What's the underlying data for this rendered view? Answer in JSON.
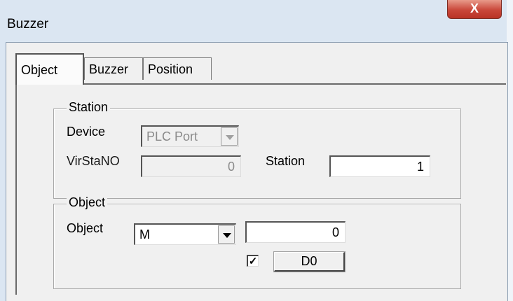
{
  "window": {
    "title": "Buzzer",
    "close_symbol": "X"
  },
  "tabs": [
    {
      "label": "Object",
      "active": true
    },
    {
      "label": "Buzzer",
      "active": false
    },
    {
      "label": "Position",
      "active": false
    }
  ],
  "station_group": {
    "label": "Station",
    "device_label": "Device",
    "device_value": "PLC Port",
    "virstano_label": "VirStaNO",
    "virstano_value": "0",
    "station_label": "Station",
    "station_value": "1"
  },
  "object_group": {
    "label": "Object",
    "object_label": "Object",
    "object_type": "M",
    "object_address": "0",
    "checkbox_checked": true,
    "checkbox_mark": "✓",
    "button_label": "D0"
  }
}
